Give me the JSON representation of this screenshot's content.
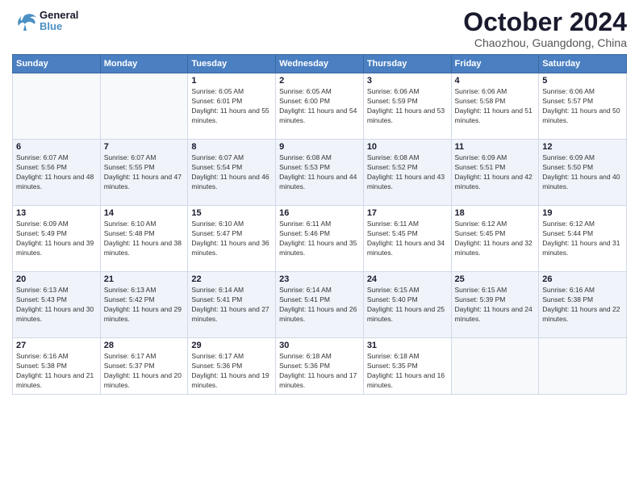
{
  "header": {
    "logo_general": "General",
    "logo_blue": "Blue",
    "month_title": "October 2024",
    "location": "Chaozhou, Guangdong, China"
  },
  "days_of_week": [
    "Sunday",
    "Monday",
    "Tuesday",
    "Wednesday",
    "Thursday",
    "Friday",
    "Saturday"
  ],
  "weeks": [
    [
      {
        "day": "",
        "info": ""
      },
      {
        "day": "",
        "info": ""
      },
      {
        "day": "1",
        "info": "Sunrise: 6:05 AM\nSunset: 6:01 PM\nDaylight: 11 hours and 55 minutes."
      },
      {
        "day": "2",
        "info": "Sunrise: 6:05 AM\nSunset: 6:00 PM\nDaylight: 11 hours and 54 minutes."
      },
      {
        "day": "3",
        "info": "Sunrise: 6:06 AM\nSunset: 5:59 PM\nDaylight: 11 hours and 53 minutes."
      },
      {
        "day": "4",
        "info": "Sunrise: 6:06 AM\nSunset: 5:58 PM\nDaylight: 11 hours and 51 minutes."
      },
      {
        "day": "5",
        "info": "Sunrise: 6:06 AM\nSunset: 5:57 PM\nDaylight: 11 hours and 50 minutes."
      }
    ],
    [
      {
        "day": "6",
        "info": "Sunrise: 6:07 AM\nSunset: 5:56 PM\nDaylight: 11 hours and 48 minutes."
      },
      {
        "day": "7",
        "info": "Sunrise: 6:07 AM\nSunset: 5:55 PM\nDaylight: 11 hours and 47 minutes."
      },
      {
        "day": "8",
        "info": "Sunrise: 6:07 AM\nSunset: 5:54 PM\nDaylight: 11 hours and 46 minutes."
      },
      {
        "day": "9",
        "info": "Sunrise: 6:08 AM\nSunset: 5:53 PM\nDaylight: 11 hours and 44 minutes."
      },
      {
        "day": "10",
        "info": "Sunrise: 6:08 AM\nSunset: 5:52 PM\nDaylight: 11 hours and 43 minutes."
      },
      {
        "day": "11",
        "info": "Sunrise: 6:09 AM\nSunset: 5:51 PM\nDaylight: 11 hours and 42 minutes."
      },
      {
        "day": "12",
        "info": "Sunrise: 6:09 AM\nSunset: 5:50 PM\nDaylight: 11 hours and 40 minutes."
      }
    ],
    [
      {
        "day": "13",
        "info": "Sunrise: 6:09 AM\nSunset: 5:49 PM\nDaylight: 11 hours and 39 minutes."
      },
      {
        "day": "14",
        "info": "Sunrise: 6:10 AM\nSunset: 5:48 PM\nDaylight: 11 hours and 38 minutes."
      },
      {
        "day": "15",
        "info": "Sunrise: 6:10 AM\nSunset: 5:47 PM\nDaylight: 11 hours and 36 minutes."
      },
      {
        "day": "16",
        "info": "Sunrise: 6:11 AM\nSunset: 5:46 PM\nDaylight: 11 hours and 35 minutes."
      },
      {
        "day": "17",
        "info": "Sunrise: 6:11 AM\nSunset: 5:45 PM\nDaylight: 11 hours and 34 minutes."
      },
      {
        "day": "18",
        "info": "Sunrise: 6:12 AM\nSunset: 5:45 PM\nDaylight: 11 hours and 32 minutes."
      },
      {
        "day": "19",
        "info": "Sunrise: 6:12 AM\nSunset: 5:44 PM\nDaylight: 11 hours and 31 minutes."
      }
    ],
    [
      {
        "day": "20",
        "info": "Sunrise: 6:13 AM\nSunset: 5:43 PM\nDaylight: 11 hours and 30 minutes."
      },
      {
        "day": "21",
        "info": "Sunrise: 6:13 AM\nSunset: 5:42 PM\nDaylight: 11 hours and 29 minutes."
      },
      {
        "day": "22",
        "info": "Sunrise: 6:14 AM\nSunset: 5:41 PM\nDaylight: 11 hours and 27 minutes."
      },
      {
        "day": "23",
        "info": "Sunrise: 6:14 AM\nSunset: 5:41 PM\nDaylight: 11 hours and 26 minutes."
      },
      {
        "day": "24",
        "info": "Sunrise: 6:15 AM\nSunset: 5:40 PM\nDaylight: 11 hours and 25 minutes."
      },
      {
        "day": "25",
        "info": "Sunrise: 6:15 AM\nSunset: 5:39 PM\nDaylight: 11 hours and 24 minutes."
      },
      {
        "day": "26",
        "info": "Sunrise: 6:16 AM\nSunset: 5:38 PM\nDaylight: 11 hours and 22 minutes."
      }
    ],
    [
      {
        "day": "27",
        "info": "Sunrise: 6:16 AM\nSunset: 5:38 PM\nDaylight: 11 hours and 21 minutes."
      },
      {
        "day": "28",
        "info": "Sunrise: 6:17 AM\nSunset: 5:37 PM\nDaylight: 11 hours and 20 minutes."
      },
      {
        "day": "29",
        "info": "Sunrise: 6:17 AM\nSunset: 5:36 PM\nDaylight: 11 hours and 19 minutes."
      },
      {
        "day": "30",
        "info": "Sunrise: 6:18 AM\nSunset: 5:36 PM\nDaylight: 11 hours and 17 minutes."
      },
      {
        "day": "31",
        "info": "Sunrise: 6:18 AM\nSunset: 5:35 PM\nDaylight: 11 hours and 16 minutes."
      },
      {
        "day": "",
        "info": ""
      },
      {
        "day": "",
        "info": ""
      }
    ]
  ]
}
